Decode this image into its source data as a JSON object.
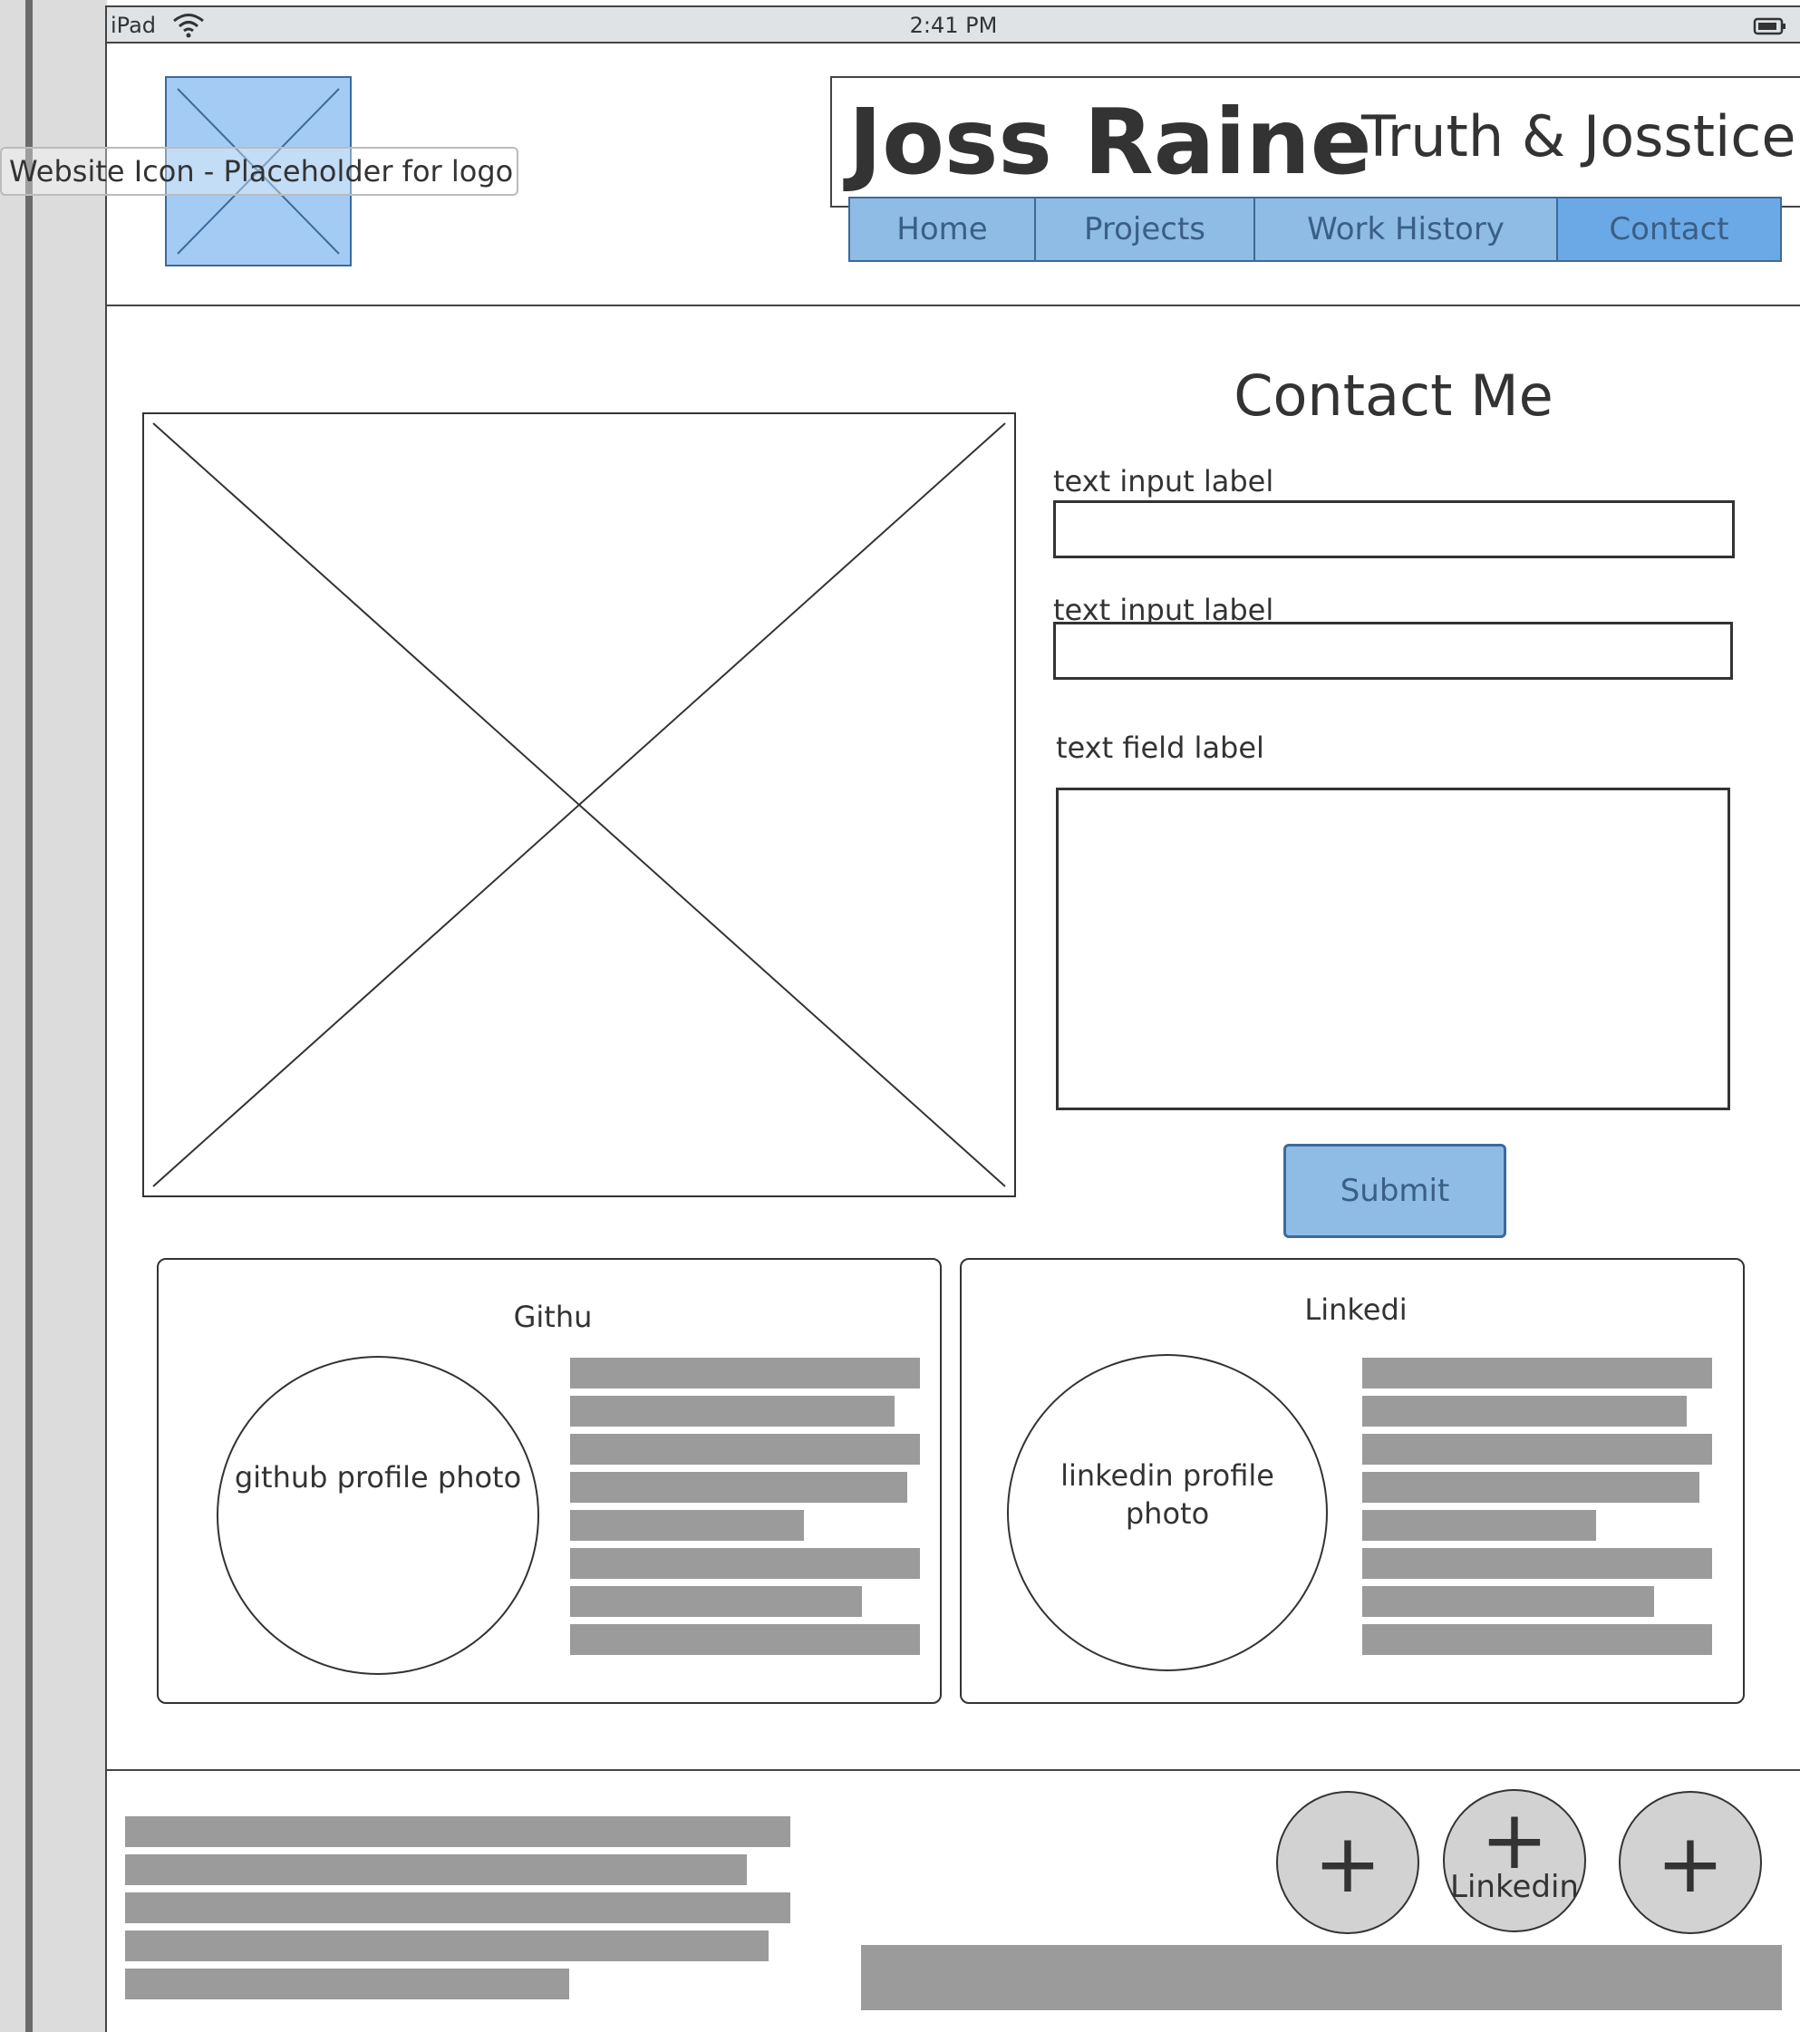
{
  "status_bar": {
    "device": "iPad",
    "time": "2:41 PM"
  },
  "header": {
    "logo_tooltip": "Website Icon - Placeholder for logo",
    "site_name": "Joss Raine",
    "tagline": "Truth & Josstice",
    "nav": [
      "Home",
      "Projects",
      "Work History",
      "Contact"
    ],
    "active_nav": "Contact"
  },
  "contact": {
    "title": "Contact Me",
    "input1_label": "text input label",
    "input2_label": "text input label",
    "textarea_label": "text field label",
    "submit_label": "Submit"
  },
  "cards": {
    "github": {
      "title": "Githu",
      "photo_label": "github profile photo"
    },
    "linkedin": {
      "title": "Linkedi",
      "photo_label": "linkedin profile photo"
    }
  },
  "footer": {
    "social_button_label": "Linkedin"
  },
  "colors": {
    "accent_blue": "#8fbce4",
    "active_blue": "#6aa9e6",
    "placeholder_gray": "#9b9b9b",
    "button_gray": "#d2d2d2"
  }
}
